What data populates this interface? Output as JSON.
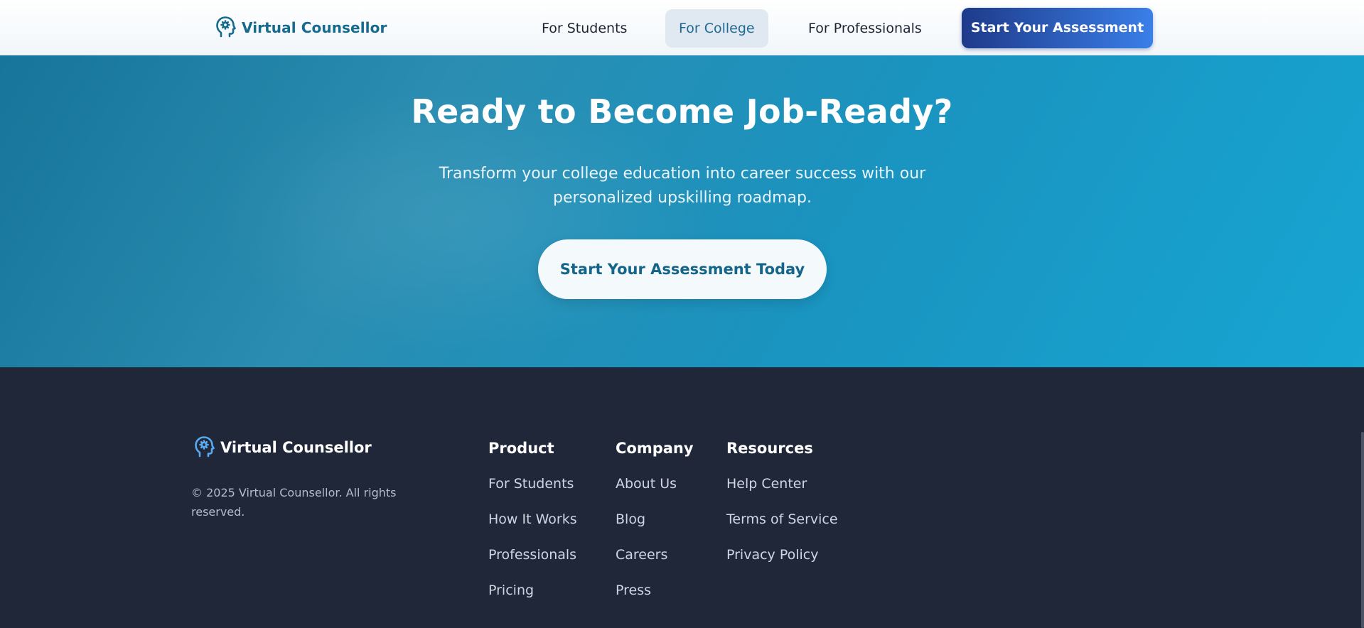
{
  "colors": {
    "brand": "#156a8d",
    "cta_gradient_start": "#1e3a8a",
    "cta_gradient_end": "#3a7fe8",
    "hero_start": "#17749a",
    "hero_end": "#17a5d2",
    "footer_bg": "#1f2739",
    "footer_icon": "#5aa9f0"
  },
  "navbar": {
    "brand_icon": "brain-head-icon",
    "brand_name": "Virtual Counsellor",
    "links": [
      {
        "label": "For Students",
        "active": false
      },
      {
        "label": "For College",
        "active": true
      },
      {
        "label": "For Professionals",
        "active": false
      }
    ],
    "cta_label": "Start Your Assessment"
  },
  "hero": {
    "title": "Ready to Become Job-Ready?",
    "subtitle": "Transform your college education into career success with our personalized upskilling roadmap.",
    "cta_label": "Start Your Assessment Today"
  },
  "footer": {
    "brand_icon": "brain-head-icon",
    "brand_name": "Virtual Counsellor",
    "copyright": "© 2025 Virtual Counsellor. All rights reserved.",
    "columns": [
      {
        "title": "Product",
        "links": [
          "For Students",
          "How It Works",
          "Professionals",
          "Pricing"
        ]
      },
      {
        "title": "Company",
        "links": [
          "About Us",
          "Blog",
          "Careers",
          "Press"
        ]
      },
      {
        "title": "Resources",
        "links": [
          "Help Center",
          "Terms of Service",
          "Privacy Policy"
        ]
      }
    ]
  }
}
